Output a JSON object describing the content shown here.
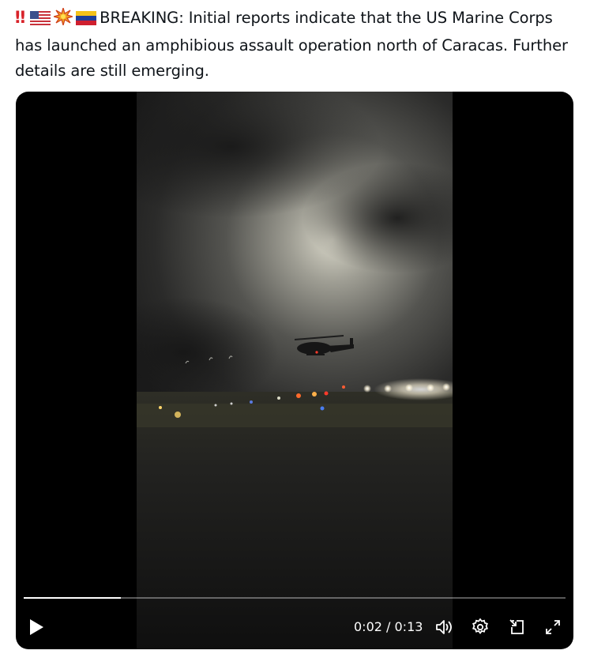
{
  "post": {
    "emoji": [
      "double-exclamation",
      "us-flag",
      "collision",
      "venezuela-flag"
    ],
    "text": "BREAKING: Initial reports indicate that the US Marine Corps has launched an amphibious assault operation north of Caracas. Further details are still emerging."
  },
  "video": {
    "current_time": "0:02",
    "separator": " / ",
    "duration": "0:13",
    "progress": 0.18,
    "controls": [
      "play-icon",
      "volume-icon",
      "settings-icon",
      "pip-icon",
      "fullscreen-icon"
    ]
  }
}
